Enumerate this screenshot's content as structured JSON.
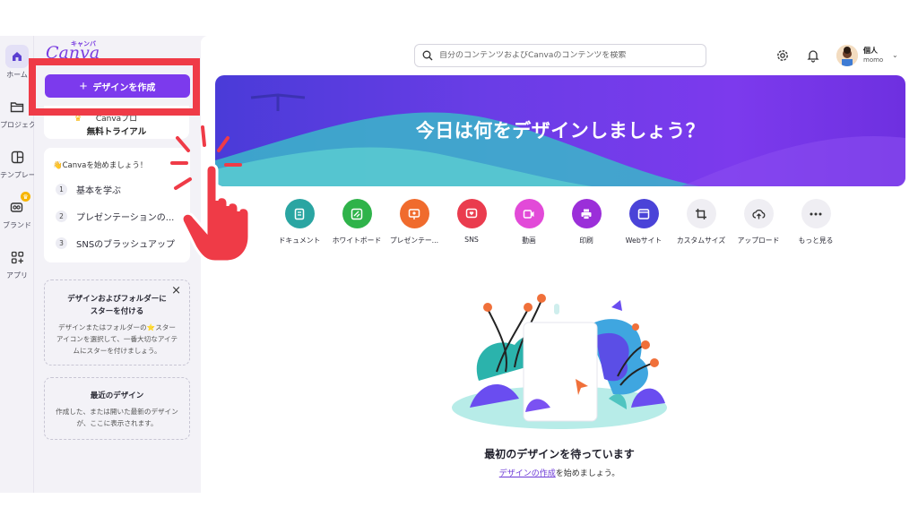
{
  "rail": {
    "items": [
      {
        "label": "ホーム",
        "icon": "home-icon",
        "active": true
      },
      {
        "label": "プロジェク",
        "icon": "folder-icon"
      },
      {
        "label": "テンプレー",
        "icon": "template-icon"
      },
      {
        "label": "ブランド",
        "icon": "brand-icon"
      },
      {
        "label": "アプリ",
        "icon": "apps-icon"
      }
    ]
  },
  "logo": {
    "kana": "キャンバ",
    "word": "Canva"
  },
  "panel": {
    "create_label": "デザインを作成",
    "pro_line1": "Canvaプロ",
    "pro_line2": "無料トライアル",
    "getting_started_title": "👋Canvaを始めましょう！",
    "steps": [
      {
        "num": "1",
        "label": "基本を学ぶ"
      },
      {
        "num": "2",
        "label": "プレゼンテーションの..."
      },
      {
        "num": "3",
        "label": "SNSのブラッシュアップ"
      }
    ],
    "star_card": {
      "title_l1": "デザインおよびフォルダーに",
      "title_l2": "スターを付ける",
      "body_l1": "デザインまたはフォルダーの⭐スター",
      "body_l2": "アイコンを選択して、一番大切なアイテ",
      "body_l3": "ムにスターを付けましょう。",
      "close": "×"
    },
    "recent_card": {
      "title": "最近のデザイン",
      "body_l1": "作成した、または開いた最新のデザイン",
      "body_l2": "が、ここに表示されます。"
    }
  },
  "header": {
    "search_placeholder": "自分のコンテンツおよびCanvaのコンテンツを検索",
    "account_name": "個人",
    "account_user": "momo"
  },
  "banner": {
    "title": "今日は何をデザインしましょう？"
  },
  "categories": [
    {
      "label": "ドキュメント",
      "color": "#2aa5a2",
      "icon": "document-icon"
    },
    {
      "label": "ホワイトボード",
      "color": "#2fb34a",
      "icon": "whiteboard-icon"
    },
    {
      "label": "プレゼンテー...",
      "color": "#f06b2d",
      "icon": "presentation-icon"
    },
    {
      "label": "SNS",
      "color": "#ea3c4e",
      "icon": "social-icon"
    },
    {
      "label": "動画",
      "color": "#e24ad8",
      "icon": "video-icon"
    },
    {
      "label": "印刷",
      "color": "#9b2fd9",
      "icon": "print-icon"
    },
    {
      "label": "Webサイト",
      "color": "#4a43d8",
      "icon": "website-icon"
    },
    {
      "label": "カスタムサイズ",
      "color": "#efeef3",
      "icon": "crop-icon"
    },
    {
      "label": "アップロード",
      "color": "#efeef3",
      "icon": "upload-cloud-icon"
    },
    {
      "label": "もっと見る",
      "color": "#efeef3",
      "icon": "more-icon"
    }
  ],
  "empty_state": {
    "title": "最初のデザインを待っています",
    "link": "デザインの作成",
    "suffix": "を始めましょう。"
  },
  "colors": {
    "accent": "#7c3aed",
    "annotation": "#ef3b47"
  }
}
